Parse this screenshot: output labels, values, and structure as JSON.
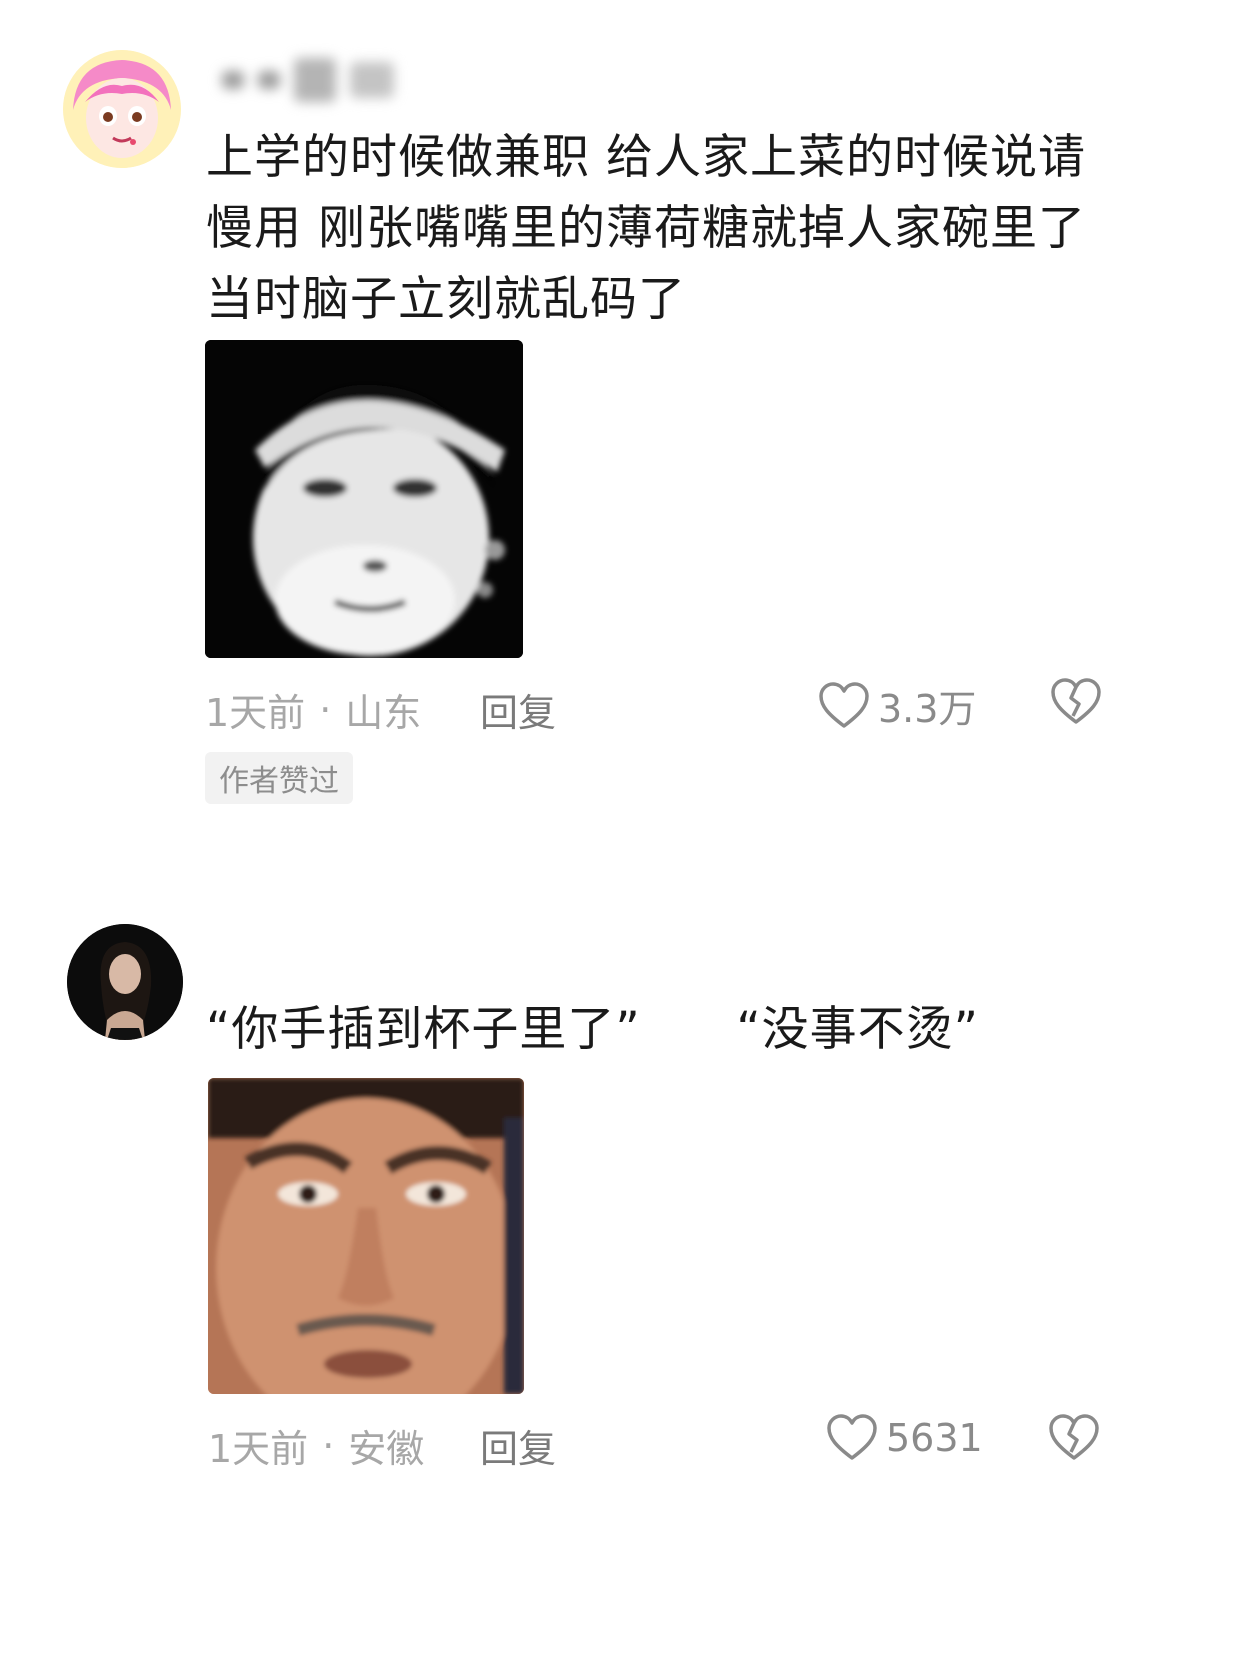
{
  "comments": [
    {
      "text": "上学的时候做兼职 给人家上菜的时候说请\n慢用 刚张嘴嘴里的薄荷糖就掉人家碗里了\n当时脑子立刻就乱码了",
      "time": "1天前",
      "separator": "·",
      "location": "山东",
      "reply_label": "回复",
      "likes": "3.3万",
      "badge": "作者赞过"
    },
    {
      "text": "“你手插到杯子里了”      “没事不烫”",
      "time": "1天前",
      "separator": "·",
      "location": "安徽",
      "reply_label": "回复",
      "likes": "5631"
    }
  ],
  "icons": {
    "like": "heart-outline-icon",
    "dislike": "broken-heart-icon"
  },
  "colors": {
    "text": "#1a1a1a",
    "meta": "#a7a7a7",
    "icon": "#8a8a8a"
  }
}
